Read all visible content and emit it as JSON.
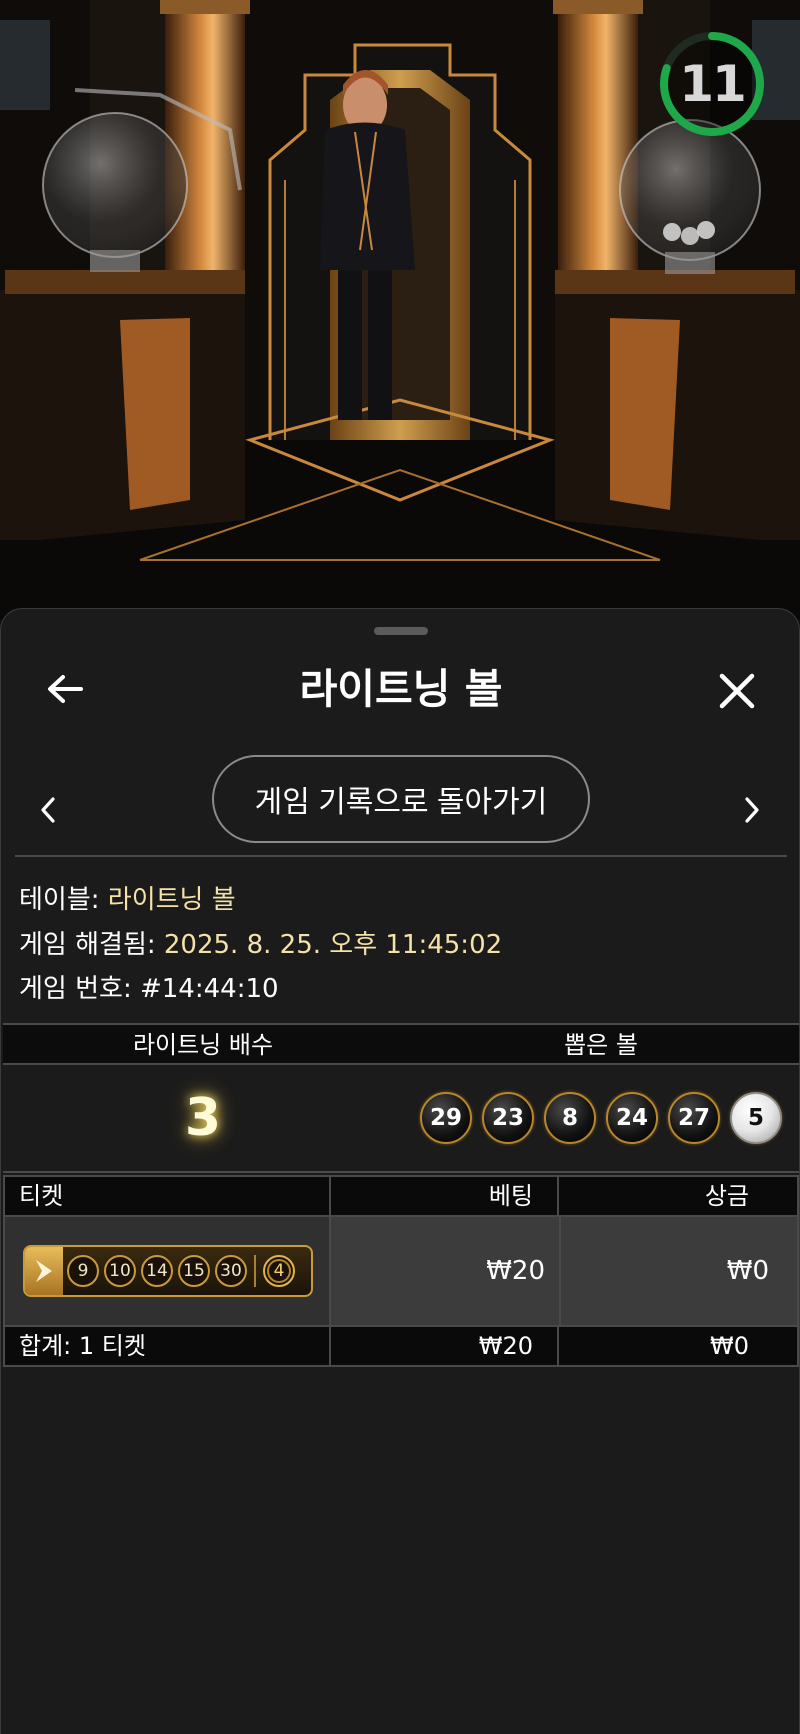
{
  "timer": {
    "value": "11"
  },
  "header": {
    "title": "라이트닝 볼"
  },
  "nav": {
    "history_button": "게임 기록으로 돌아가기"
  },
  "info": {
    "table_label": "테이블:",
    "table_value": "라이트닝 볼",
    "resolved_label": "게임 해결됨:",
    "resolved_value": "2025. 8. 25. 오후 11:45:02",
    "game_no_label": "게임 번호:",
    "game_no_value": "#14:44:10"
  },
  "result": {
    "multiplier_header": "라이트닝 배수",
    "drawn_header": "뽑은 볼",
    "multiplier": "3",
    "drawn_balls": [
      "29",
      "23",
      "8",
      "24",
      "27"
    ],
    "bonus_ball": "5"
  },
  "tickets": {
    "headers": {
      "ticket": "티켓",
      "bet": "베팅",
      "win": "상금"
    },
    "rows": [
      {
        "numbers": [
          "9",
          "10",
          "14",
          "15",
          "30"
        ],
        "bonus": "4",
        "bet": "₩20",
        "win": "₩0"
      }
    ],
    "total": {
      "label": "합계: 1 티켓",
      "bet": "₩20",
      "win": "₩0"
    }
  },
  "colors": {
    "accent_gold": "#c99a3a",
    "value_yellow": "#f4e2a8",
    "timer_green": "#1fa84a"
  },
  "icons": [
    "back-arrow-icon",
    "close-icon",
    "chevron-left-icon",
    "chevron-right-icon",
    "ticket-logo-icon"
  ]
}
